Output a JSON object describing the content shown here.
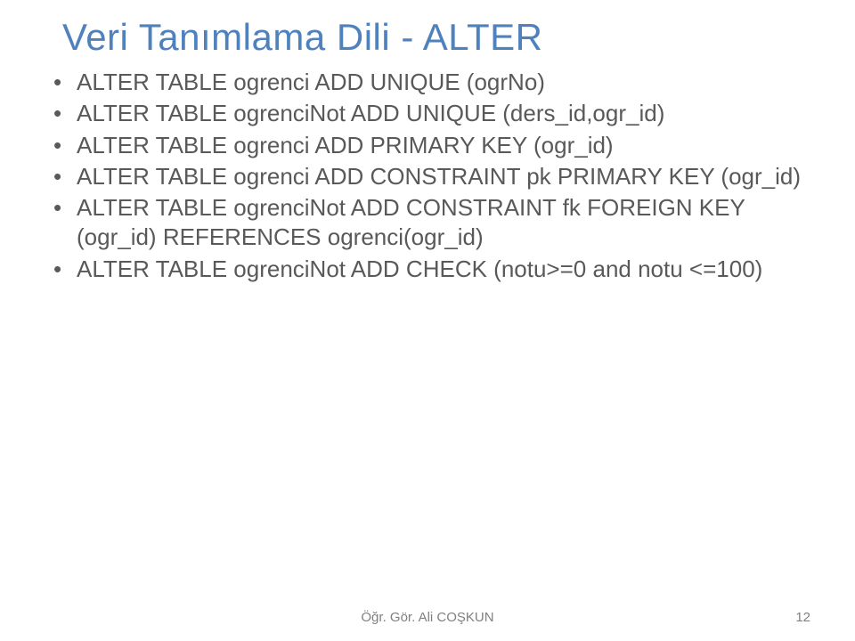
{
  "title": "Veri Tanımlama Dili - ALTER",
  "bullets": [
    "ALTER TABLE ogrenci ADD UNIQUE (ogrNo)",
    "ALTER TABLE ogrenciNot ADD UNIQUE (ders_id,ogr_id)",
    "ALTER TABLE ogrenci ADD PRIMARY KEY (ogr_id)",
    "ALTER TABLE ogrenci ADD CONSTRAINT pk PRIMARY KEY (ogr_id)",
    "ALTER TABLE ogrenciNot ADD CONSTRAINT fk FOREIGN KEY (ogr_id) REFERENCES ogrenci(ogr_id)",
    "ALTER TABLE ogrenciNot ADD CHECK (notu>=0 and notu <=100)"
  ],
  "footer": "Öğr. Gör. Ali COŞKUN",
  "page_number": "12"
}
